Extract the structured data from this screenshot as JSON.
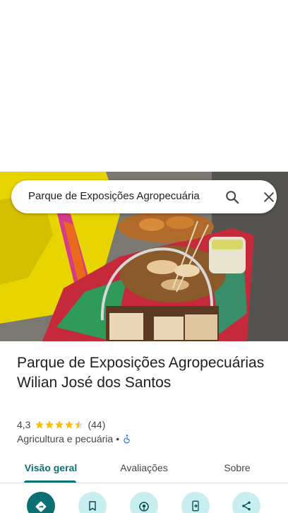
{
  "search": {
    "query": "Parque de Exposições Agropecuária",
    "search_icon": "search-icon",
    "close_icon": "close-icon"
  },
  "photo": {
    "description_icon": "place-photo"
  },
  "place": {
    "name": "Parque de Exposições Agropecuárias Wilian José dos Santos",
    "rating": "4,3",
    "stars_filled": 4.3,
    "reviews_count": "(44)",
    "category": "Agricultura e pecuária",
    "separator": "•",
    "accessibility_icon": "wheelchair-icon"
  },
  "tabs": [
    {
      "label": "Visão geral",
      "active": true
    },
    {
      "label": "Avaliações",
      "active": false
    },
    {
      "label": "Sobre",
      "active": false
    }
  ],
  "actions": [
    {
      "icon": "directions-icon"
    },
    {
      "icon": "bookmark-icon"
    },
    {
      "icon": "nearby-icon"
    },
    {
      "icon": "send-to-phone-icon"
    },
    {
      "icon": "share-icon"
    }
  ],
  "colors": {
    "accent": "#0b6f74",
    "action_bg": "#c8eef0",
    "star": "#fbbc04",
    "accessibility": "#1a73e8"
  }
}
